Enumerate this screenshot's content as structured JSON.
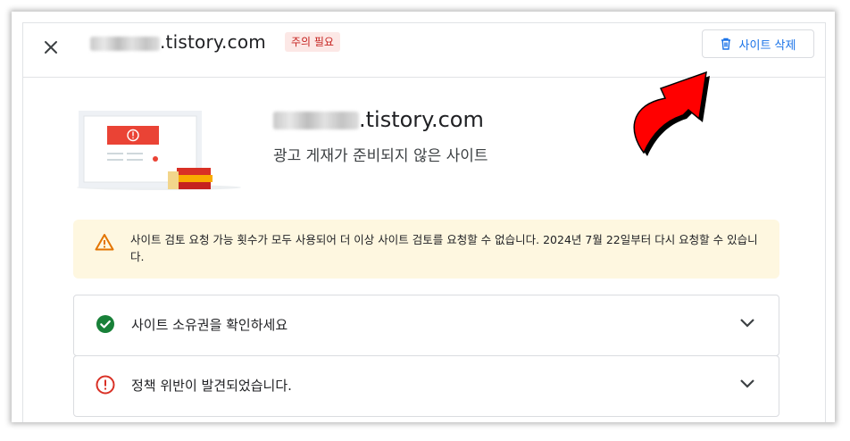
{
  "header": {
    "close_icon": "close-icon",
    "domain_suffix": ".tistory.com",
    "badge": "주의 필요",
    "delete_button": "사이트 삭제"
  },
  "site": {
    "domain_suffix": ".tistory.com",
    "status": "광고 게재가 준비되지 않은 사이트"
  },
  "warning": {
    "icon": "warning-triangle-icon",
    "text": "사이트 검토 요청 가능 횟수가 모두 사용되어 더 이상 사이트 검토를 요청할 수 없습니다. 2024년 7월 22일부터 다시 요청할 수 있습니다."
  },
  "sections": [
    {
      "label": "사이트 소유권을 확인하세요",
      "icon": "check-circle-icon",
      "status_color": "#188038"
    },
    {
      "label": "정책 위반이 발견되었습니다.",
      "icon": "error-circle-icon",
      "status_color": "#d93025"
    }
  ],
  "colors": {
    "accent": "#1a73e8",
    "badge_bg": "#fce8e6",
    "badge_text": "#c5221f",
    "warning_bg": "#fef7e0",
    "warning_icon": "#e37400",
    "annotation_arrow": "#ff0000"
  }
}
